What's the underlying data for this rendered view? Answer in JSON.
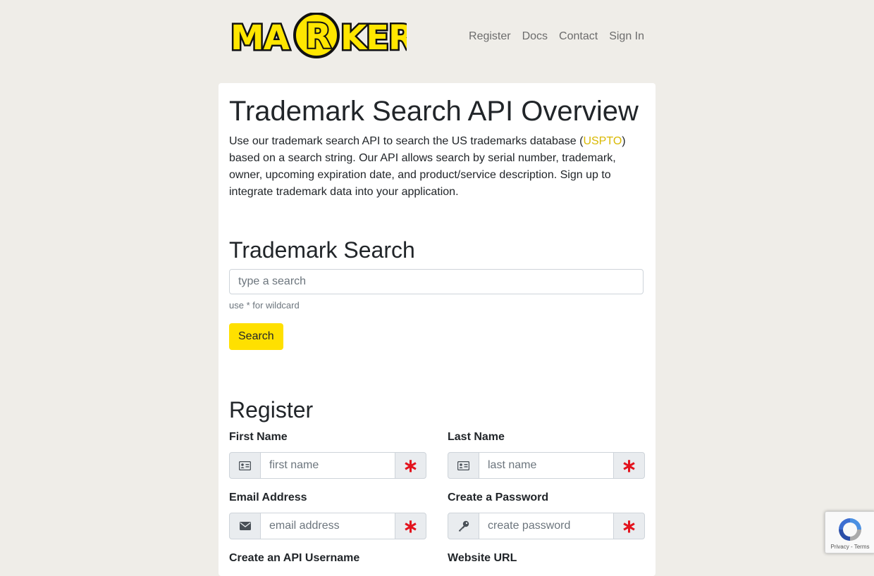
{
  "header": {
    "logo_text": "MARKER",
    "nav": [
      "Register",
      "Docs",
      "Contact",
      "Sign In"
    ]
  },
  "overview": {
    "title": "Trademark Search API Overview",
    "intro_before": "Use our trademark search API to search the US trademarks database (",
    "intro_link": "USPTO",
    "intro_after": ") based on a search string. Our API allows search by serial number, trademark, owner, upcoming expiration date, and product/service description. Sign up to integrate trademark data into your application."
  },
  "search": {
    "heading": "Trademark Search",
    "placeholder": "type a search",
    "hint": "use * for wildcard",
    "button_label": "Search"
  },
  "register": {
    "heading": "Register",
    "fields": [
      {
        "label": "First Name",
        "placeholder": "first name",
        "icon": "id-card-icon"
      },
      {
        "label": "Last Name",
        "placeholder": "last name",
        "icon": "id-card-icon"
      },
      {
        "label": "Email Address",
        "placeholder": "email address",
        "icon": "envelope-icon"
      },
      {
        "label": "Create a Password",
        "placeholder": "create password",
        "icon": "key-icon"
      },
      {
        "label": "Create an API Username",
        "placeholder": "",
        "icon": ""
      },
      {
        "label": "Website URL",
        "placeholder": "",
        "icon": ""
      }
    ],
    "required_marker": "∗"
  },
  "recaptcha": {
    "links": "Privacy - Terms"
  },
  "colors": {
    "accent": "#ffe000",
    "logo_yellow": "#ffe600",
    "required": "#e3141e",
    "link": "#d9b800",
    "page_bg": "#efede8"
  }
}
